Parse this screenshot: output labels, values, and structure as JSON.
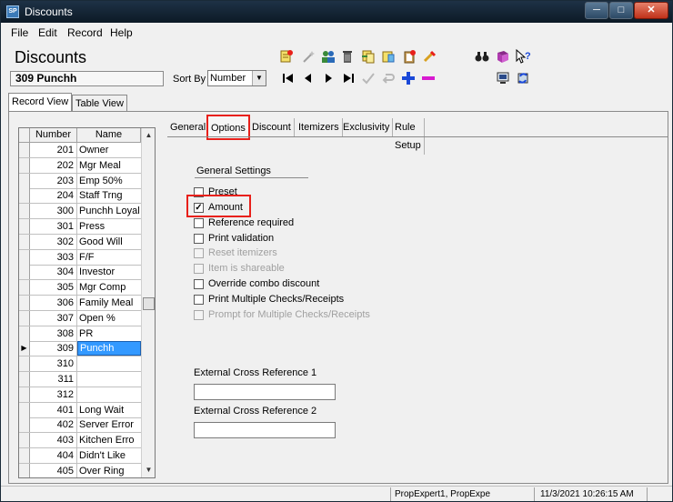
{
  "window": {
    "title": "Discounts",
    "app_icon": "app-icon"
  },
  "menu": [
    "File",
    "Edit",
    "Record",
    "Help"
  ],
  "header": {
    "title": "Discounts",
    "current_record": "309 Punchh"
  },
  "sort": {
    "label": "Sort By",
    "value": "Number"
  },
  "view_tabs": [
    "Record View",
    "Table View"
  ],
  "grid": {
    "columns": [
      "Number",
      "Name"
    ],
    "rows": [
      {
        "number": "201",
        "name": "Owner"
      },
      {
        "number": "202",
        "name": "Mgr Meal"
      },
      {
        "number": "203",
        "name": "Emp 50%"
      },
      {
        "number": "204",
        "name": "Staff Trng"
      },
      {
        "number": "300",
        "name": "Punchh Loyal"
      },
      {
        "number": "301",
        "name": "Press"
      },
      {
        "number": "302",
        "name": "Good Will"
      },
      {
        "number": "303",
        "name": "F/F"
      },
      {
        "number": "304",
        "name": "Investor"
      },
      {
        "number": "305",
        "name": "Mgr Comp"
      },
      {
        "number": "306",
        "name": "Family Meal"
      },
      {
        "number": "307",
        "name": "Open %"
      },
      {
        "number": "308",
        "name": "PR"
      },
      {
        "number": "309",
        "name": "Punchh"
      },
      {
        "number": "310",
        "name": ""
      },
      {
        "number": "311",
        "name": ""
      },
      {
        "number": "312",
        "name": ""
      },
      {
        "number": "401",
        "name": "Long Wait"
      },
      {
        "number": "402",
        "name": "Server Error"
      },
      {
        "number": "403",
        "name": "Kitchen Erro"
      },
      {
        "number": "404",
        "name": "Didn't Like"
      },
      {
        "number": "405",
        "name": "Over Ring"
      }
    ],
    "selected_number": "309"
  },
  "tabs": [
    "General",
    "Options",
    "Discount",
    "Itemizers",
    "Exclusivity",
    "Rule Setup"
  ],
  "active_tab": "Options",
  "options": {
    "section_title": "General Settings",
    "items": [
      {
        "label": "Preset",
        "checked": false,
        "enabled": true
      },
      {
        "label": "Amount",
        "checked": true,
        "enabled": true
      },
      {
        "label": "Reference required",
        "checked": false,
        "enabled": true
      },
      {
        "label": "Print validation",
        "checked": false,
        "enabled": true
      },
      {
        "label": "Reset itemizers",
        "checked": false,
        "enabled": false
      },
      {
        "label": "Item is shareable",
        "checked": false,
        "enabled": false
      },
      {
        "label": "Override combo discount",
        "checked": false,
        "enabled": true
      },
      {
        "label": "Print Multiple Checks/Receipts",
        "checked": false,
        "enabled": true
      },
      {
        "label": "Prompt for Multiple Checks/Receipts",
        "checked": false,
        "enabled": false
      }
    ]
  },
  "external": {
    "ref1_label": "External Cross Reference 1",
    "ref1_value": "",
    "ref2_label": "External Cross Reference 2",
    "ref2_value": ""
  },
  "status": {
    "user": "PropExpert1, PropExpe",
    "datetime": "11/3/2021 10:26:15 AM"
  },
  "colors": {
    "highlight": "#e8201a",
    "selection": "#3399ff",
    "add": "#1a48d8",
    "remove": "#d81ad0"
  }
}
